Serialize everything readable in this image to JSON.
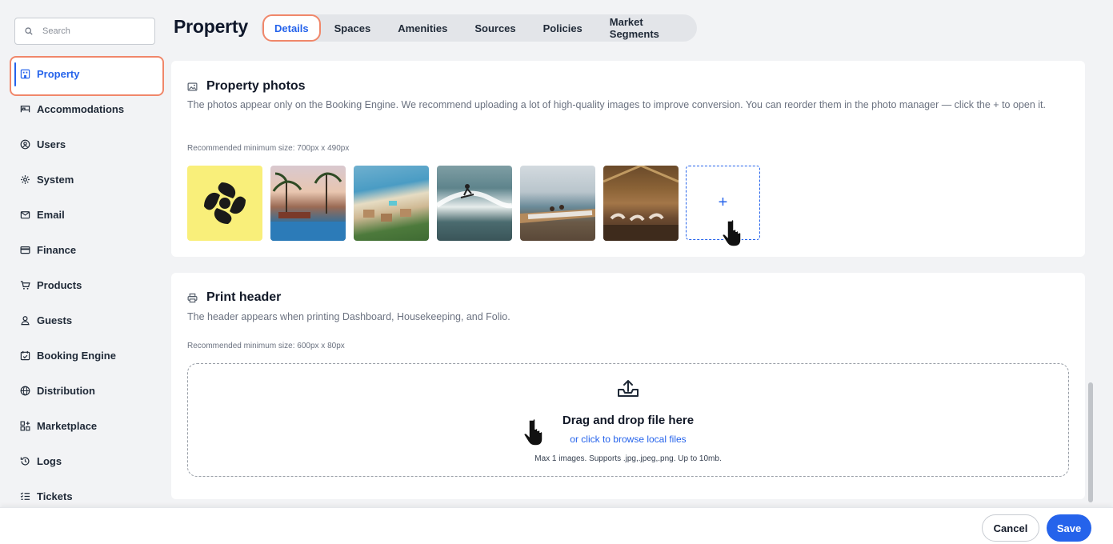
{
  "search": {
    "placeholder": "Search"
  },
  "sidebar": {
    "items": [
      {
        "label": "Property",
        "icon": "building-icon",
        "active": true
      },
      {
        "label": "Accommodations",
        "icon": "bed-icon"
      },
      {
        "label": "Users",
        "icon": "user-circle-icon"
      },
      {
        "label": "System",
        "icon": "gear-icon"
      },
      {
        "label": "Email",
        "icon": "mail-icon"
      },
      {
        "label": "Finance",
        "icon": "credit-card-icon"
      },
      {
        "label": "Products",
        "icon": "cart-icon"
      },
      {
        "label": "Guests",
        "icon": "person-icon"
      },
      {
        "label": "Booking Engine",
        "icon": "calendar-check-icon"
      },
      {
        "label": "Distribution",
        "icon": "globe-icon"
      },
      {
        "label": "Marketplace",
        "icon": "apps-plus-icon"
      },
      {
        "label": "Logs",
        "icon": "history-icon"
      },
      {
        "label": "Tickets",
        "icon": "checklist-icon"
      }
    ]
  },
  "header": {
    "title": "Property",
    "tabs": [
      {
        "label": "Details",
        "active": true
      },
      {
        "label": "Spaces"
      },
      {
        "label": "Amenities"
      },
      {
        "label": "Sources"
      },
      {
        "label": "Policies"
      },
      {
        "label": "Market Segments"
      }
    ]
  },
  "photos_section": {
    "icon": "image-icon",
    "title": "Property photos",
    "description": "The photos appear only on the Booking Engine. We recommend uploading a lot of high-quality images to improve conversion. You can reorder them in the photo manager — click the + to open it.",
    "size_note": "Recommended minimum size: 700px x 490px",
    "photos": [
      {
        "name": "logo-photo"
      },
      {
        "name": "pool-sunset-photo"
      },
      {
        "name": "beach-aerial-photo"
      },
      {
        "name": "surfer-photo"
      },
      {
        "name": "hammock-photo"
      },
      {
        "name": "yoga-photo"
      }
    ],
    "add_label": "+"
  },
  "print_section": {
    "icon": "printer-icon",
    "title": "Print header",
    "description": "The header appears when printing Dashboard, Housekeeping, and Folio.",
    "size_note": "Recommended minimum size: 600px x 80px",
    "dropzone": {
      "icon": "upload-icon",
      "title": "Drag and drop file here",
      "link": "or click to browse local files",
      "hint": "Max 1 images. Supports .jpg,.jpeg,.png. Up to 10mb."
    }
  },
  "footer": {
    "cancel_label": "Cancel",
    "save_label": "Save"
  },
  "colors": {
    "accent": "#2563eb",
    "highlight": "#f0876a",
    "background": "#f2f3f5"
  }
}
